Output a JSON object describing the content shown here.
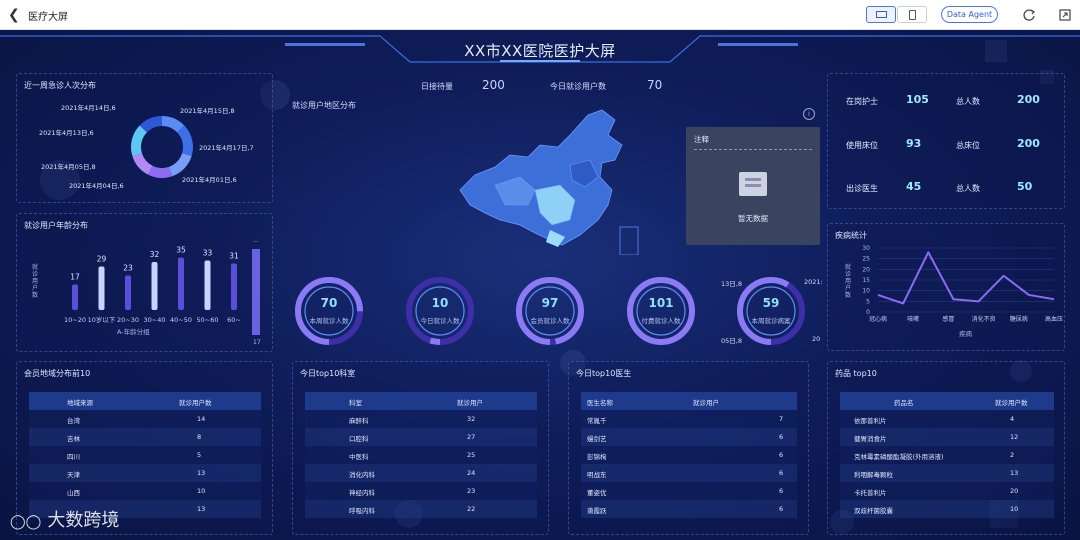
{
  "topbar": {
    "title": "医疗大屏",
    "agent": "Data Agent"
  },
  "header": {
    "title": "XX市XX医院医护大屏"
  },
  "summary": {
    "waiting_label": "日接待量",
    "waiting_value": "200",
    "today_label": "今日就诊用户数",
    "today_value": "70"
  },
  "map": {
    "title": "就诊用户地区分布"
  },
  "tooltip": {
    "title": "注释",
    "empty": "暂无数据"
  },
  "weekly": {
    "title": "近一周急诊人次分布",
    "chart_data": {
      "type": "pie",
      "labels": [
        "2021年4月14日,6",
        "2021年4月15日,8",
        "2021年4月17日,7",
        "2021年4月01日,6",
        "2021年4月04日,6",
        "2021年4月05日,8",
        "2021年4月13日,6"
      ],
      "values": [
        6,
        8,
        7,
        6,
        6,
        8,
        6
      ],
      "colors": [
        "#5b8cf5",
        "#3f6fe8",
        "#7b9df7",
        "#8c6cf2",
        "#b089f7",
        "#5dc9f3",
        "#2d59d6"
      ]
    }
  },
  "age": {
    "title": "就诊用户年龄分布",
    "xlabel": "A-年龄分组",
    "ylabel": "就诊用户数",
    "chart_data": {
      "type": "bar",
      "categories": [
        "10~20",
        "10岁以下",
        "20~30",
        "30~40",
        "40~50",
        "50~60",
        "60~"
      ],
      "values": [
        17,
        29,
        23,
        32,
        35,
        33,
        31
      ],
      "ylim": [
        0,
        40
      ]
    },
    "legend_top": "...",
    "legend_bottom": "17"
  },
  "rings": [
    {
      "value": "70",
      "label": "本周就诊人数",
      "frac": 0.75
    },
    {
      "value": "10",
      "label": "今日就诊人数",
      "frac": 0.05
    },
    {
      "value": "97",
      "label": "会员就诊人数",
      "frac": 0.97
    },
    {
      "value": "101",
      "label": "付费就诊人数",
      "frac": 1.0
    },
    {
      "value": "59",
      "label": "本周就诊病案",
      "frac": 0.59
    }
  ],
  "ring_aux": {
    "a": "13日,8",
    "b": "2021:",
    "c": "05日,8",
    "d": "20"
  },
  "staff": {
    "rows": [
      {
        "l1": "在岗护士",
        "v1": "105",
        "l2": "总人数",
        "v2": "200"
      },
      {
        "l1": "使用床位",
        "v1": "93",
        "l2": "总床位",
        "v2": "200"
      },
      {
        "l1": "出诊医生",
        "v1": "45",
        "l2": "总人数",
        "v2": "50"
      }
    ]
  },
  "disease": {
    "title": "疾病统计",
    "xlabel": "疾病",
    "ylabel": "就诊用户数",
    "chart_data": {
      "type": "line",
      "categories": [
        "冠心病",
        "咳嗽",
        "感冒",
        "消化不良",
        "糖尿病",
        "高血压"
      ],
      "values": [
        8,
        4,
        28,
        6,
        5,
        17,
        8,
        6
      ],
      "yticks": [
        "30",
        "25",
        "20",
        "15",
        "10",
        "5",
        "0"
      ],
      "ylim": [
        0,
        30
      ]
    }
  },
  "members": {
    "title": "会员地域分布前10",
    "col1": "地域来源",
    "col2": "就诊用户数",
    "rows": [
      [
        "台湾",
        "14"
      ],
      [
        "吉林",
        "8"
      ],
      [
        "四川",
        "5"
      ],
      [
        "天津",
        "13"
      ],
      [
        "山西",
        "10"
      ],
      [
        "",
        "13"
      ]
    ]
  },
  "depts": {
    "title": "今日top10科室",
    "col1": "科室",
    "col2": "就诊用户",
    "rows": [
      [
        "麻醉科",
        "32"
      ],
      [
        "口腔科",
        "27"
      ],
      [
        "中医科",
        "25"
      ],
      [
        "消化内科",
        "24"
      ],
      [
        "神经内科",
        "23"
      ],
      [
        "呼吸内科",
        "22"
      ]
    ]
  },
  "doctors": {
    "title": "今日top10医生",
    "col1": "医生名称",
    "col2": "就诊用户",
    "rows": [
      [
        "常胤千",
        "7"
      ],
      [
        "嫚剑艺",
        "6"
      ],
      [
        "彭锦栒",
        "6"
      ],
      [
        "明战东",
        "6"
      ],
      [
        "董姿优",
        "6"
      ],
      [
        "萧霞跃",
        "6"
      ]
    ]
  },
  "drugs": {
    "title": "药品 top10",
    "col1": "药品名",
    "col2": "就诊用户数",
    "rows": [
      [
        "依那普利片",
        "4"
      ],
      [
        "健胃消食片",
        "12"
      ],
      [
        "克林霉素磷酸酯凝胶(外用溶液)",
        "2"
      ],
      [
        "利咽解毒颗粒",
        "13"
      ],
      [
        "卡托普利片",
        "20"
      ],
      [
        "双歧杆菌胶囊",
        "10"
      ]
    ]
  },
  "watermark": "大数跨境"
}
